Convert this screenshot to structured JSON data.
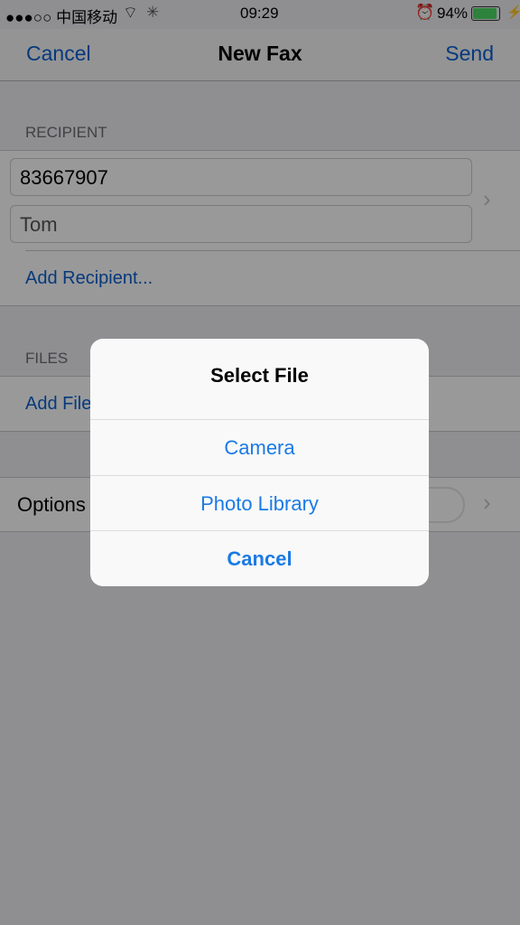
{
  "status_bar": {
    "carrier": "●●●○○ 中国移动",
    "time": "09:29",
    "battery": "94%",
    "battery_level": 0.94,
    "battery_color": "#4cd964"
  },
  "nav": {
    "cancel": "Cancel",
    "title": "New Fax",
    "send": "Send"
  },
  "recipient": {
    "header": "RECIPIENT",
    "number": "83667907",
    "name": "Tom",
    "add": "Add Recipient..."
  },
  "files": {
    "header": "FILES",
    "add": "Add File"
  },
  "options": {
    "label": "Options",
    "toggle_on": false
  },
  "alert": {
    "title": "Select File",
    "actions": [
      "Camera",
      "Photo Library"
    ],
    "cancel": "Cancel"
  }
}
